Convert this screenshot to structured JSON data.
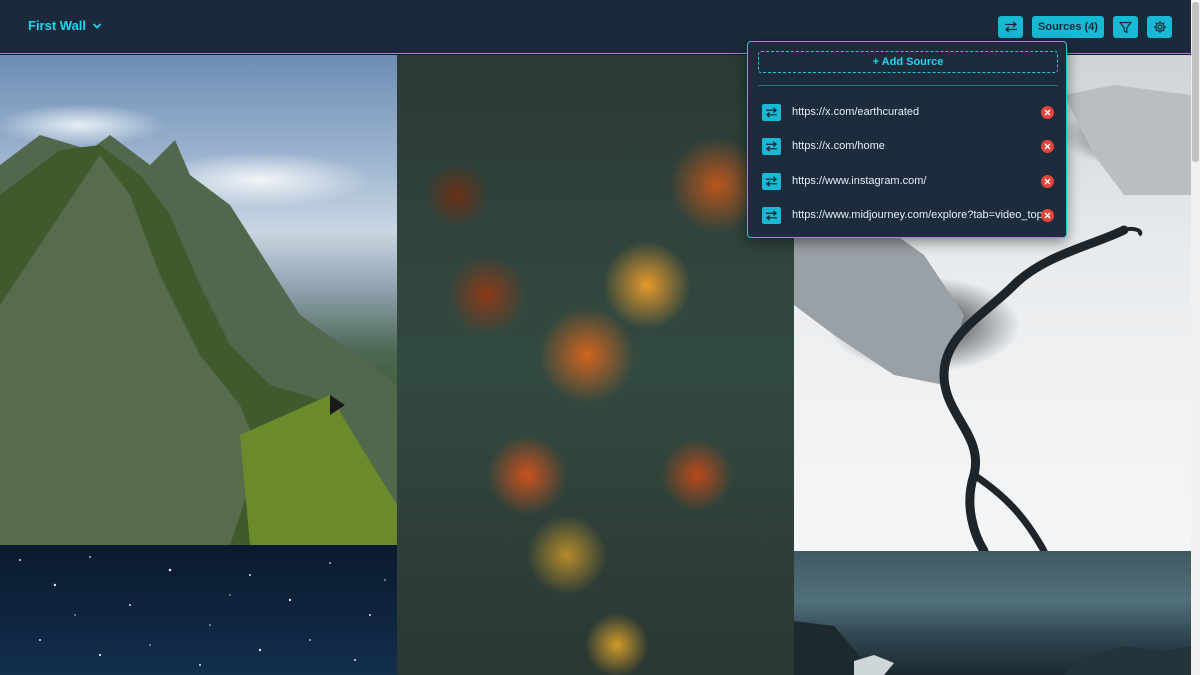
{
  "header": {
    "wall_title": "First Wall",
    "sources_label": "Sources (4)"
  },
  "sources_panel": {
    "add_label": "+ Add Source",
    "items": [
      {
        "url": "https://x.com/earthcurated"
      },
      {
        "url": "https://x.com/home"
      },
      {
        "url": "https://www.instagram.com/"
      },
      {
        "url": "https://www.midjourney.com/explore?tab=video_top"
      }
    ]
  },
  "wall_images": [
    "mountain-ridge-photo",
    "autumn-forest-aerial-photo",
    "snowy-river-photo",
    "starry-sky-photo",
    "stormy-mountains-photo"
  ],
  "icons": {
    "swap": "swap-arrows-icon",
    "filter": "filter-icon",
    "settings": "gear-icon",
    "remove": "close-icon"
  },
  "colors": {
    "accent": "#22d3ee",
    "button": "#18b9d5",
    "header_bg": "#1b2a3a",
    "panel_bg": "#1c2c3d",
    "remove": "#e5453a"
  }
}
